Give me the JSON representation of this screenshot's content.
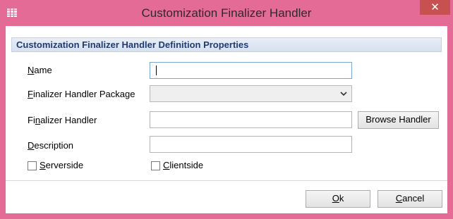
{
  "window": {
    "title": "Customization Finalizer Handler",
    "close_glyph": "✕",
    "icon": "table-grid-icon",
    "frame_color": "#e46b96",
    "close_color": "#c75050"
  },
  "group": {
    "header": "Customization Finalizer Handler Definition Properties"
  },
  "fields": {
    "name": {
      "label_mnemonic": "N",
      "label_rest": "ame",
      "value": ""
    },
    "package": {
      "label_mnemonic": "F",
      "label_rest": "inalizer Handler Package",
      "value": ""
    },
    "handler": {
      "label_pre": "Fi",
      "label_mnemonic": "n",
      "label_rest": "alizer Handler",
      "value": ""
    },
    "description": {
      "label_mnemonic": "D",
      "label_rest": "escription",
      "value": ""
    }
  },
  "checkboxes": {
    "serverside": {
      "label_mnemonic": "S",
      "label_rest": "erverside",
      "checked": false
    },
    "clientside": {
      "label_mnemonic": "C",
      "label_rest": "lientside",
      "checked": false
    }
  },
  "buttons": {
    "browse_handler": "Browse Handler",
    "ok": {
      "mnemonic": "O",
      "rest": "k"
    },
    "cancel": {
      "mnemonic": "C",
      "rest": "ancel"
    }
  }
}
